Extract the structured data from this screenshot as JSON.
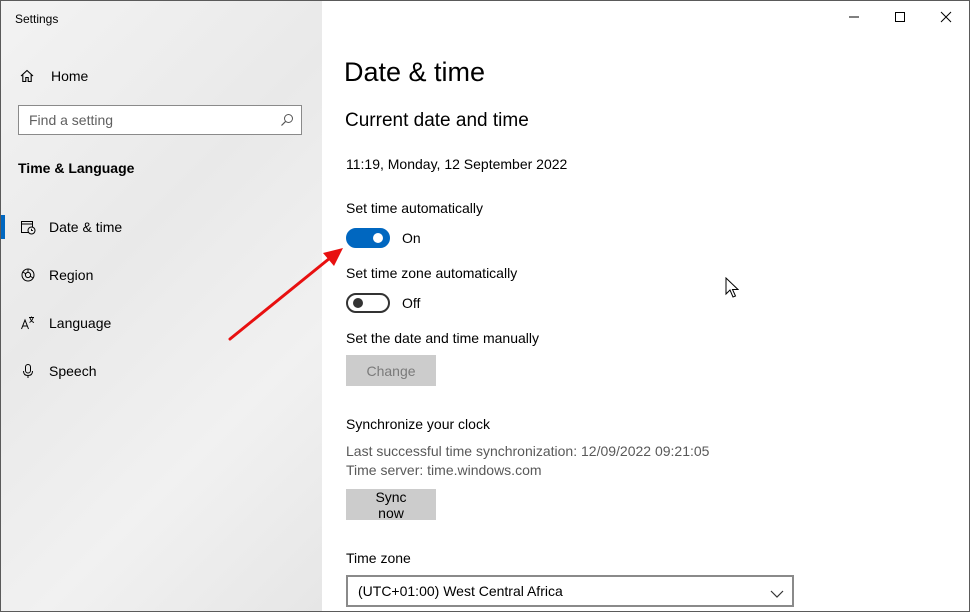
{
  "window": {
    "title": "Settings"
  },
  "sidebar": {
    "home_label": "Home",
    "search": {
      "placeholder": "Find a setting"
    },
    "section_title": "Time & Language",
    "items": [
      {
        "label": "Date & time",
        "icon": "calendar-clock-icon",
        "selected": true
      },
      {
        "label": "Region",
        "icon": "globe-icon",
        "selected": false
      },
      {
        "label": "Language",
        "icon": "language-icon",
        "selected": false
      },
      {
        "label": "Speech",
        "icon": "microphone-icon",
        "selected": false
      }
    ]
  },
  "main": {
    "title": "Date & time",
    "subheading": "Current date and time",
    "current_datetime": "11:19, Monday, 12 September 2022",
    "set_time_auto": {
      "label": "Set time automatically",
      "state_label": "On",
      "on": true
    },
    "set_timezone_auto": {
      "label": "Set time zone automatically",
      "state_label": "Off",
      "on": false
    },
    "manual": {
      "label": "Set the date and time manually",
      "button_label": "Change",
      "enabled": false
    },
    "sync": {
      "heading": "Synchronize your clock",
      "last_sync": "Last successful time synchronization: 12/09/2022 09:21:05",
      "server": "Time server: time.windows.com",
      "button_label": "Sync now"
    },
    "timezone": {
      "label": "Time zone",
      "value": "(UTC+01:00) West Central Africa"
    }
  },
  "colors": {
    "accent": "#0067c0",
    "annotation_arrow": "#e81010",
    "sidebar_bg": "#efefef",
    "button_bg": "#cccccc"
  }
}
